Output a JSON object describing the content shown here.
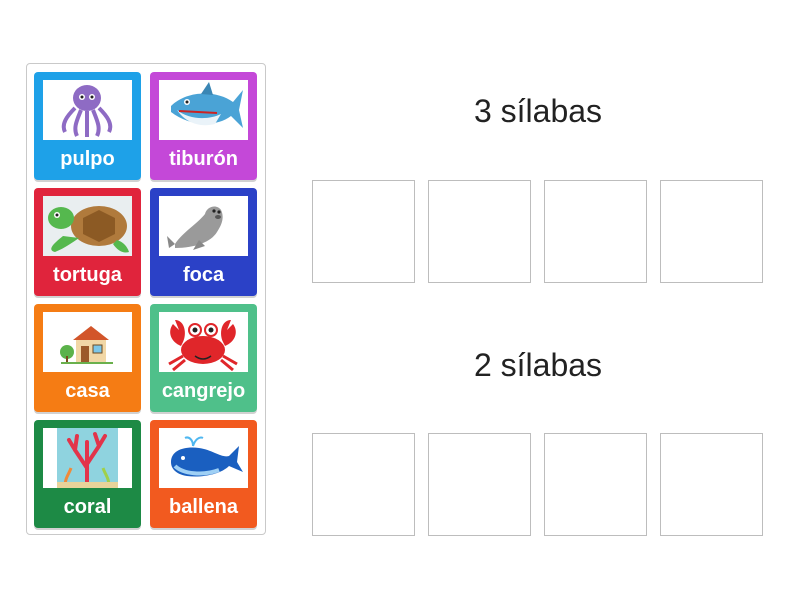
{
  "cards": [
    {
      "id": "pulpo",
      "label": "pulpo",
      "color": "#1ea1e8",
      "icon": "octopus-icon"
    },
    {
      "id": "tiburon",
      "label": "tiburón",
      "color": "#c448d8",
      "icon": "shark-icon"
    },
    {
      "id": "tortuga",
      "label": "tortuga",
      "color": "#e0243c",
      "icon": "turtle-icon"
    },
    {
      "id": "foca",
      "label": "foca",
      "color": "#2b41c7",
      "icon": "seal-icon"
    },
    {
      "id": "casa",
      "label": "casa",
      "color": "#f57c14",
      "icon": "house-icon"
    },
    {
      "id": "cangrejo",
      "label": "cangrejo",
      "color": "#4fc08a",
      "icon": "crab-icon"
    },
    {
      "id": "coral",
      "label": "coral",
      "color": "#1d8a45",
      "icon": "coral-icon"
    },
    {
      "id": "ballena",
      "label": "ballena",
      "color": "#f25a1f",
      "icon": "whale-icon"
    }
  ],
  "groups": [
    {
      "title": "3 sílabas",
      "slots": 4
    },
    {
      "title": "2 sílabas",
      "slots": 4
    }
  ]
}
